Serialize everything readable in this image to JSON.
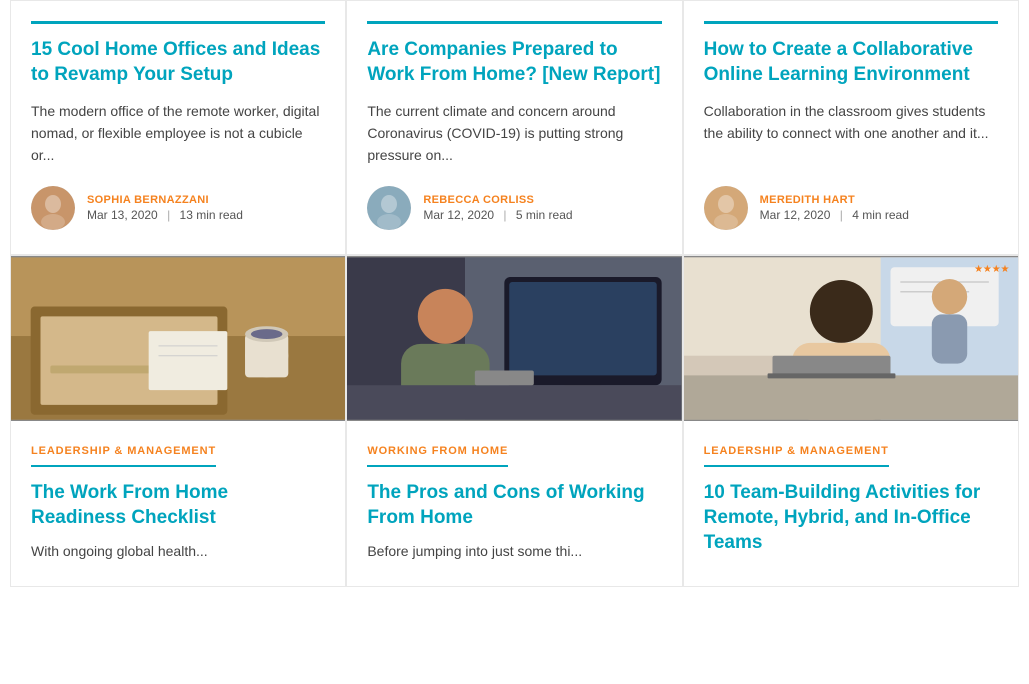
{
  "cards_top": [
    {
      "title": "15 Cool Home Offices and Ideas to Revamp Your Setup",
      "excerpt": "The modern office of the remote worker, digital nomad, or flexible employee is not a cubicle or...",
      "author_name": "SOPHIA BERNAZZANI",
      "date": "Mar 13, 2020",
      "read_time": "13 min read",
      "avatar_color": "#c8956a"
    },
    {
      "title": "Are Companies Prepared to Work From Home? [New Report]",
      "excerpt": "The current climate and concern around Coronavirus (COVID-19) is putting strong pressure on...",
      "author_name": "REBECCA CORLISS",
      "date": "Mar 12, 2020",
      "read_time": "5 min read",
      "avatar_color": "#8aabbc"
    },
    {
      "title": "How to Create a Collaborative Online Learning Environment",
      "excerpt": "Collaboration in the classroom gives students the ability to connect with one another and it...",
      "author_name": "MEREDITH HART",
      "date": "Mar 12, 2020",
      "read_time": "4 min read",
      "avatar_color": "#d4a878"
    }
  ],
  "cards_bottom": [
    {
      "category": "LEADERSHIP & MANAGEMENT",
      "title": "The Work From Home Readiness Checklist",
      "excerpt": "With ongoing global health...",
      "img_class": "img1"
    },
    {
      "category": "WORKING FROM HOME",
      "title": "The Pros and Cons of Working From Home",
      "excerpt": "Before jumping into just some thi...",
      "img_class": "img2"
    },
    {
      "category": "LEADERSHIP & MANAGEMENT",
      "title": "10 Team-Building Activities for Remote, Hybrid, and In-Office Teams",
      "excerpt": "",
      "img_class": "img3"
    }
  ],
  "meta_separator": "|"
}
